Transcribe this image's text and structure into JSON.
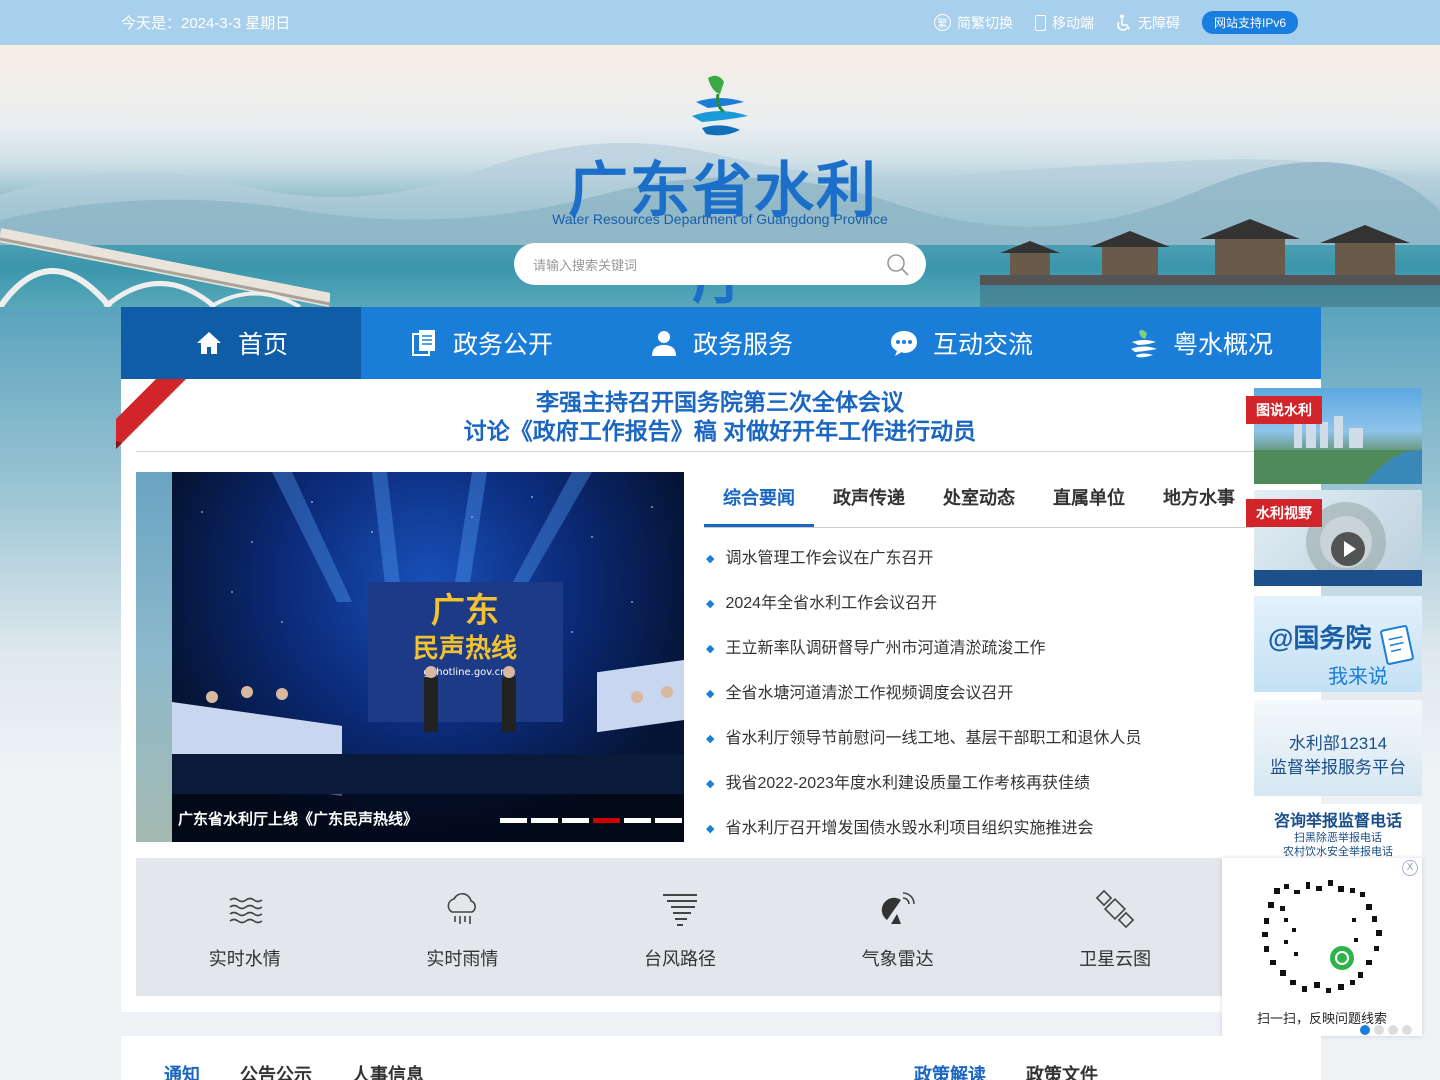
{
  "topbar": {
    "date": "今天是：2024-3-3 星期日",
    "links": [
      {
        "label": "简繁切换",
        "icon": "traditional-chinese-icon"
      },
      {
        "label": "移动端",
        "icon": "mobile-icon"
      },
      {
        "label": "无障碍",
        "icon": "accessibility-icon"
      }
    ],
    "ipv6": "网站支持IPv6"
  },
  "header": {
    "title": "广东省水利厅",
    "subtitle": "Water Resources Department of Guangdong Province",
    "search_placeholder": "请输入搜索关键词"
  },
  "nav": [
    {
      "label": "首页",
      "icon": "home-icon",
      "active": true
    },
    {
      "label": "政务公开",
      "icon": "documents-icon",
      "active": false
    },
    {
      "label": "政务服务",
      "icon": "user-icon",
      "active": false
    },
    {
      "label": "互动交流",
      "icon": "chat-icon",
      "active": false
    },
    {
      "label": "粤水概况",
      "icon": "guangdong-logo-icon",
      "active": false
    }
  ],
  "headline": {
    "line1": "李强主持召开国务院第三次全体会议",
    "line2": "讨论《政府工作报告》稿 对做好开年工作进行动员"
  },
  "slider": {
    "caption": "广东省水利厅上线《广东民声热线》",
    "dot_count": 6,
    "active_dot": 4
  },
  "news_tabs": [
    "综合要闻",
    "政声传递",
    "处室动态",
    "直属单位",
    "地方水事"
  ],
  "news": [
    "调水管理工作会议在广东召开",
    "2024年全省水利工作会议召开",
    "王立新率队调研督导广州市河道清淤疏浚工作",
    "全省水塘河道清淤工作视频调度会议召开",
    "省水利厅领导节前慰问一线工地、基层干部职工和退休人员",
    "我省2022-2023年度水利建设质量工作考核再获佳绩",
    "省水利厅召开增发国债水毁水利项目组织实施推进会"
  ],
  "tools": [
    {
      "label": "实时水情",
      "icon": "water-waves-icon"
    },
    {
      "label": "实时雨情",
      "icon": "rain-cloud-icon"
    },
    {
      "label": "台风路径",
      "icon": "typhoon-icon"
    },
    {
      "label": "气象雷达",
      "icon": "radar-icon"
    },
    {
      "label": "卫星云图",
      "icon": "satellite-icon"
    }
  ],
  "side": {
    "tag1": "图说水利",
    "tag2": "水利视野",
    "gwy_line1": "@国务院",
    "gwy_line2": "我来说",
    "mwr_line1": "水利部12314",
    "mwr_line2": "监督举报服务平台",
    "hotline_title": "咨询举报监督电话",
    "hotline_1": "扫黑除恶举报电话",
    "hotline_2": "农村饮水安全举报电话"
  },
  "qr": {
    "caption": "扫一扫，反映问题线索",
    "close": "X"
  },
  "bottom_tabs": [
    "通知",
    "公告公示",
    "人事信息"
  ],
  "bottom_tabs_right": [
    "政策解读",
    "政策文件"
  ],
  "colors": {
    "primary": "#1a7ed8",
    "nav_active": "#0f5da6",
    "headline": "#1a66c0",
    "tag_red": "#d2252b"
  }
}
